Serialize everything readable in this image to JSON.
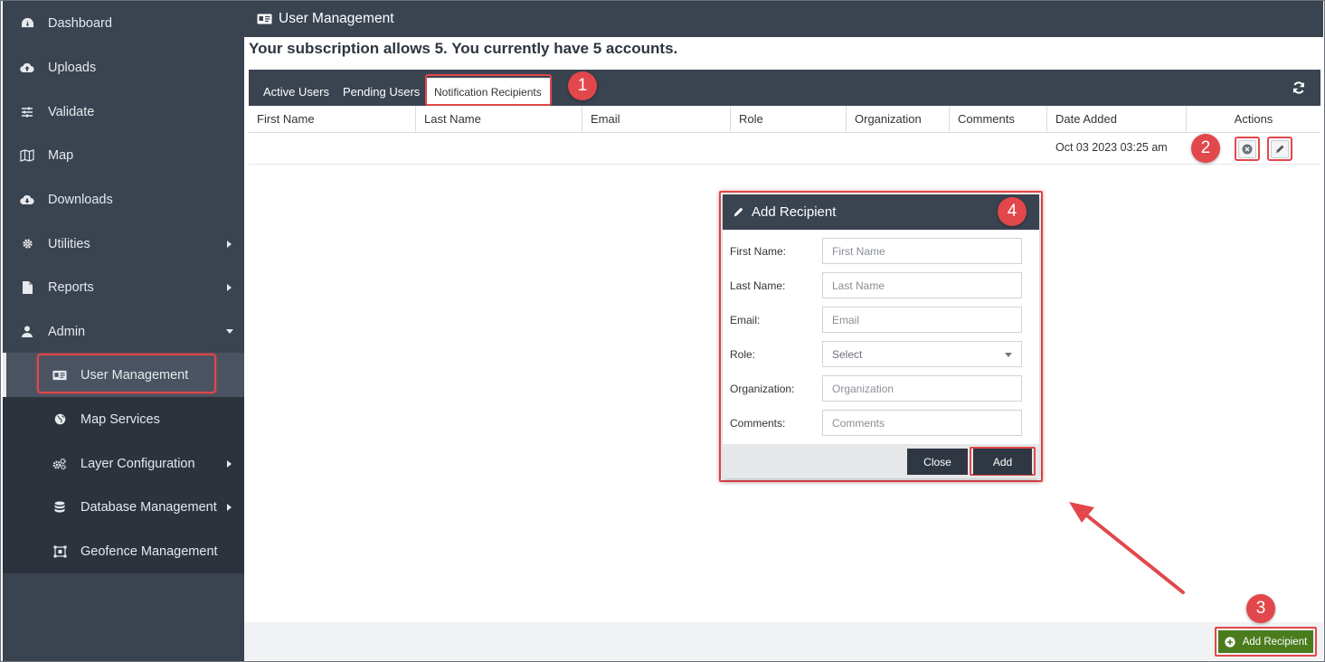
{
  "sidebar": {
    "items": [
      {
        "label": "Dashboard",
        "icon": "dashboard-icon"
      },
      {
        "label": "Uploads",
        "icon": "cloud-upload-icon"
      },
      {
        "label": "Validate",
        "icon": "sliders-icon"
      },
      {
        "label": "Map",
        "icon": "map-icon"
      },
      {
        "label": "Downloads",
        "icon": "cloud-download-icon"
      },
      {
        "label": "Utilities",
        "icon": "gear-icon"
      },
      {
        "label": "Reports",
        "icon": "file-icon"
      },
      {
        "label": "Admin",
        "icon": "user-icon"
      }
    ],
    "admin_sub": [
      {
        "label": "User Management",
        "icon": "id-card-icon"
      },
      {
        "label": "Map Services",
        "icon": "globe-icon"
      },
      {
        "label": "Layer Configuration",
        "icon": "gears-icon"
      },
      {
        "label": "Database Management",
        "icon": "database-icon"
      },
      {
        "label": "Geofence Management",
        "icon": "geofence-icon"
      }
    ]
  },
  "header": {
    "title": "User Management"
  },
  "subscription": {
    "text": "Your subscription allows 5. You currently have 5 accounts."
  },
  "tabs": {
    "active_users": "Active Users",
    "pending_users": "Pending Users",
    "notification_recipients": "Notification Recipients"
  },
  "table": {
    "columns": [
      "First Name",
      "Last Name",
      "Email",
      "Role",
      "Organization",
      "Comments",
      "Date Added",
      "Actions"
    ],
    "rows": [
      {
        "first": "",
        "last": "",
        "email": "",
        "role": "",
        "org": "",
        "comments": "",
        "date": "Oct 03 2023 03:25 am"
      }
    ]
  },
  "badges": {
    "one": "1",
    "two": "2",
    "three": "3",
    "four": "4"
  },
  "modal": {
    "title": "Add Recipient",
    "fields": {
      "first_label": "First Name:",
      "first_ph": "First Name",
      "last_label": "Last Name:",
      "last_ph": "Last Name",
      "email_label": "Email:",
      "email_ph": "Email",
      "role_label": "Role:",
      "role_value": "Select",
      "org_label": "Organization:",
      "org_ph": "Organization",
      "comments_label": "Comments:",
      "comments_ph": "Comments"
    },
    "close_label": "Close",
    "add_label": "Add"
  },
  "footer": {
    "add_recipient_label": "Add Recipient"
  },
  "colors": {
    "accent_red": "#e2474b",
    "nav_dark": "#3a4350",
    "add_green": "#4a7c1e"
  }
}
